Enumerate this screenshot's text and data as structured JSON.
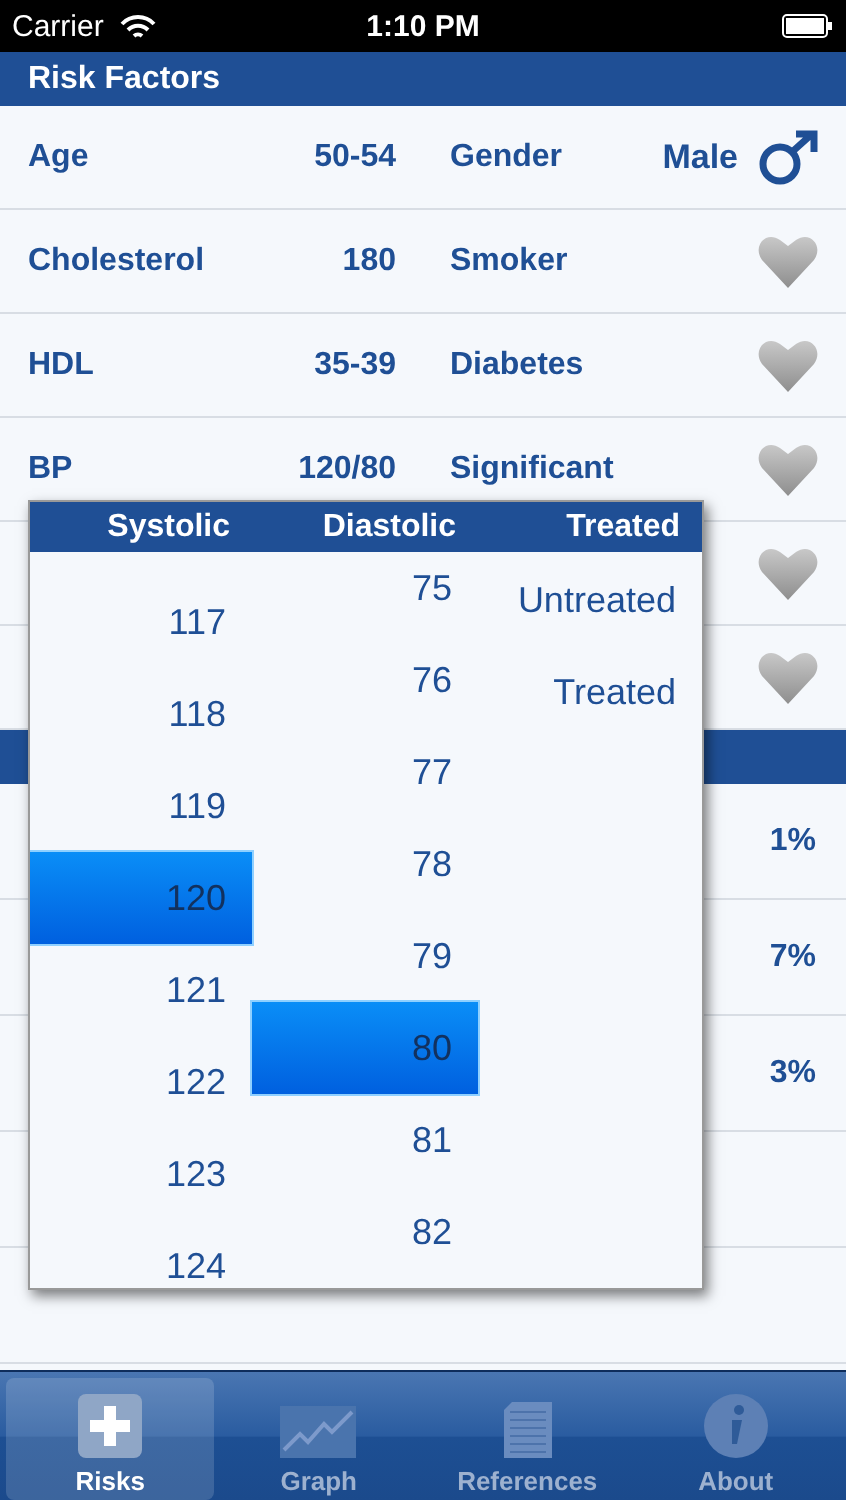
{
  "status_bar": {
    "carrier": "Carrier",
    "time": "1:10 PM"
  },
  "header": {
    "title": "Risk Factors"
  },
  "risk_rows": [
    {
      "label": "Age",
      "value": "50-54",
      "label2": "Gender",
      "value2": "Male",
      "kind": "gender"
    },
    {
      "label": "Cholesterol",
      "value": "180",
      "label2": "Smoker",
      "kind": "toggle"
    },
    {
      "label": "HDL",
      "value": "35-39",
      "label2": "Diabetes",
      "kind": "toggle"
    },
    {
      "label": "BP",
      "value": "120/80",
      "label2": "Significant",
      "kind": "toggle"
    },
    {
      "kind": "toggle"
    },
    {
      "kind": "toggle"
    }
  ],
  "results": [
    {
      "value": "1%"
    },
    {
      "value": "7%"
    },
    {
      "value": "3%"
    }
  ],
  "picker": {
    "columns": [
      {
        "title": "Systolic",
        "items": [
          {
            "label": "117",
            "selected": false
          },
          {
            "label": "118",
            "selected": false
          },
          {
            "label": "119",
            "selected": false
          },
          {
            "label": "120",
            "selected": true
          },
          {
            "label": "121",
            "selected": false
          },
          {
            "label": "122",
            "selected": false
          },
          {
            "label": "123",
            "selected": false
          },
          {
            "label": "124",
            "selected": false
          }
        ]
      },
      {
        "title": "Diastolic",
        "items": [
          {
            "label": "75",
            "selected": false
          },
          {
            "label": "76",
            "selected": false
          },
          {
            "label": "77",
            "selected": false
          },
          {
            "label": "78",
            "selected": false
          },
          {
            "label": "79",
            "selected": false
          },
          {
            "label": "80",
            "selected": true
          },
          {
            "label": "81",
            "selected": false
          },
          {
            "label": "82",
            "selected": false
          }
        ]
      },
      {
        "title": "Treated",
        "items": [
          {
            "label": "Untreated",
            "selected": false
          },
          {
            "label": "Treated",
            "selected": false
          }
        ]
      }
    ]
  },
  "tabs": [
    {
      "label": "Risks",
      "selected": true
    },
    {
      "label": "Graph",
      "selected": false
    },
    {
      "label": "References",
      "selected": false
    },
    {
      "label": "About",
      "selected": false
    }
  ]
}
